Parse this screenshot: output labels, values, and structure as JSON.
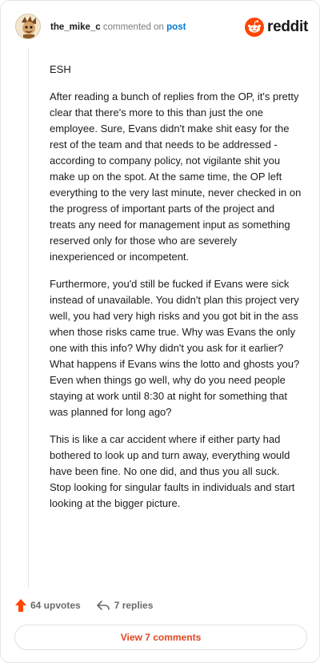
{
  "header": {
    "username": "the_mike_c",
    "commented_on": "commented on",
    "post_link": "post",
    "brand": "reddit"
  },
  "comment": {
    "paragraphs": [
      "ESH",
      "After reading a bunch of replies from the OP, it's pretty clear that there's more to this than just the one employee. Sure, Evans didn't make shit easy for the rest of the team and that needs to be addressed - according to company policy, not vigilante shit you make up on the spot. At the same time, the OP left everything to the very last minute, never checked in on the progress of important parts of the project and treats any need for management input as something reserved only for those who are severely inexperienced or incompetent.",
      "Furthermore, you'd still be fucked if Evans were sick instead of unavailable. You didn't plan this project very well, you had very high risks and you got bit in the ass when those risks came true. Why was Evans the only one with this info? Why didn't you ask for it earlier? What happens if Evans wins the lotto and ghosts you? Even when things go well, why do you need people staying at work until 8:30 at night for something that was planned for long ago?",
      "This is like a car accident where if either party had bothered to look up and turn away, everything would have been fine. No one did, and thus you all suck. Stop looking for singular faults in individuals and start looking at the bigger picture."
    ]
  },
  "footer": {
    "upvotes_label": "64 upvotes",
    "replies_label": "7 replies",
    "view_comments_label": "View 7 comments"
  },
  "colors": {
    "accent": "#ff4500",
    "link": "#0079d3",
    "view_button_text": "#e0461e"
  }
}
